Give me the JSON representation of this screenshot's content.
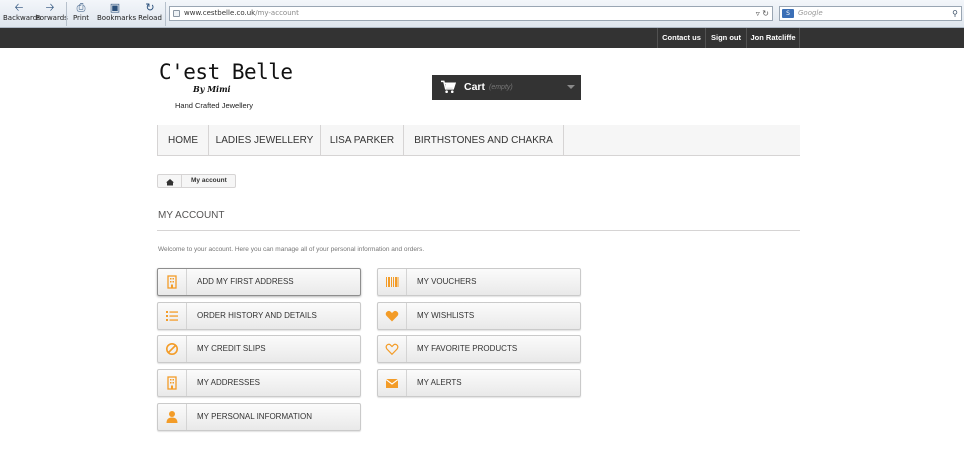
{
  "browser": {
    "nav_buttons": [
      "Backwards",
      "Forwards",
      "Print",
      "Bookmarks",
      "Reload"
    ],
    "url_domain": "www.cestbelle.co.uk",
    "url_path": "/my-account",
    "search_engine_icon": "S",
    "search_placeholder": "Google"
  },
  "top_bar": {
    "contact": "Contact us",
    "sign_out": "Sign out",
    "user": "Jon Ratcliffe"
  },
  "header": {
    "logo_title": "C'est Belle",
    "logo_subtitle": "By Mimi",
    "logo_tagline": "Hand Crafted Jewellery",
    "cart_label": "Cart",
    "cart_status": "(empty)"
  },
  "menu": {
    "items": [
      "HOME",
      "LADIES JEWELLERY",
      "LISA PARKER",
      "BIRTHSTONES AND CHAKRA"
    ]
  },
  "breadcrumb": {
    "current": "My account"
  },
  "page": {
    "title": "MY ACCOUNT",
    "welcome": "Welcome to your account. Here you can manage all of your personal information and orders."
  },
  "account_links": {
    "left": [
      {
        "label": "ADD MY FIRST ADDRESS",
        "icon": "building-icon"
      },
      {
        "label": "ORDER HISTORY AND DETAILS",
        "icon": "list-icon"
      },
      {
        "label": "MY CREDIT SLIPS",
        "icon": "ban-icon"
      },
      {
        "label": "MY ADDRESSES",
        "icon": "building-icon"
      },
      {
        "label": "MY PERSONAL INFORMATION",
        "icon": "user-icon"
      }
    ],
    "right": [
      {
        "label": "MY VOUCHERS",
        "icon": "barcode-icon"
      },
      {
        "label": "MY WISHLISTS",
        "icon": "heart-icon"
      },
      {
        "label": "MY FAVORITE PRODUCTS",
        "icon": "heart-outline-icon"
      },
      {
        "label": "MY ALERTS",
        "icon": "envelope-icon"
      }
    ]
  },
  "colors": {
    "accent_orange": "#f39c28",
    "dark_bar": "#333333"
  }
}
